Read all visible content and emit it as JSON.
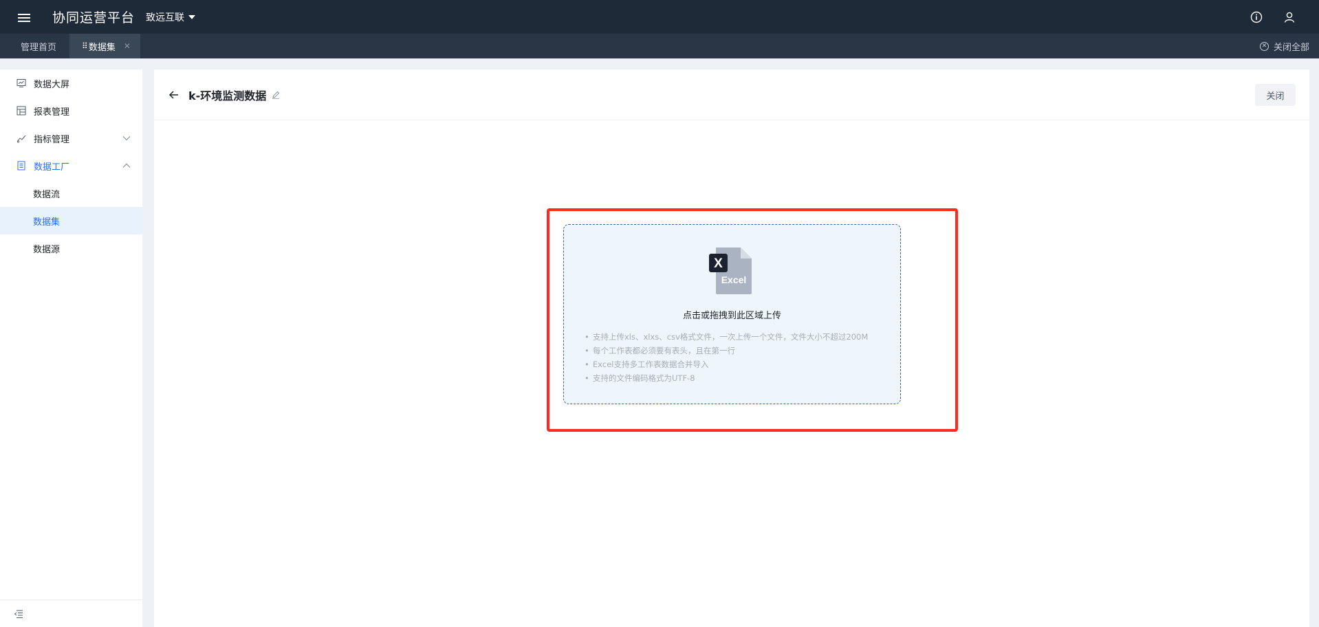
{
  "header": {
    "app_title": "协同运营平台",
    "org_name": "致远互联"
  },
  "tabs": {
    "items": [
      {
        "label": "管理首页"
      },
      {
        "label": "数据集"
      }
    ],
    "close_all": "关闭全部"
  },
  "sidebar": {
    "items": [
      {
        "label": "数据大屏"
      },
      {
        "label": "报表管理"
      },
      {
        "label": "指标管理"
      },
      {
        "label": "数据工厂"
      }
    ],
    "sub_items": [
      {
        "label": "数据流"
      },
      {
        "label": "数据集"
      },
      {
        "label": "数据源"
      }
    ]
  },
  "page": {
    "title": "k-环境监测数据",
    "close_label": "关闭"
  },
  "upload": {
    "icon_text": "Excel",
    "icon_badge": "X",
    "title": "点击或拖拽到此区域上传",
    "hints": [
      "支持上传xls、xlxs、csv格式文件，一次上传一个文件，文件大小不超过200M",
      "每个工作表都必须要有表头，且在第一行",
      "Excel支持多工作表数据合并导入",
      "支持的文件编码格式为UTF-8"
    ]
  },
  "colors": {
    "topbar": "#1f2a38",
    "accent": "#2d6cf0",
    "highlight": "#ff2a1f"
  }
}
